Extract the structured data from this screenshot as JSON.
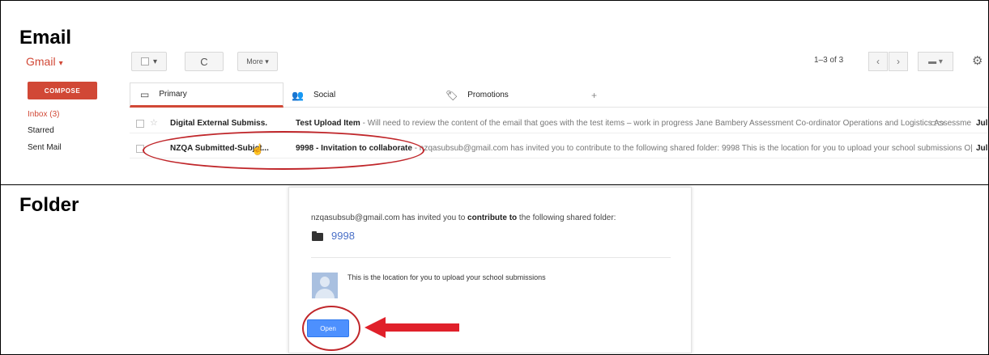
{
  "sections": {
    "email_label": "Email",
    "folder_label": "Folder"
  },
  "gmail": {
    "logo": "Gmail",
    "toolbar": {
      "refresh_glyph": "C",
      "more_label": "More",
      "count": "1–3 of 3"
    },
    "compose_label": "COMPOSE",
    "nav": {
      "inbox": "Inbox (3)",
      "starred": "Starred",
      "sent": "Sent Mail"
    },
    "tabs": [
      "Primary",
      "Social",
      "Promotions"
    ],
    "emails": [
      {
        "sender": "Digital External Submiss.",
        "subject": "Test Upload Item",
        "snippet": " - Will need to review the content of the email that goes with the test items – work in progress Jane Bambery Assessment Co-ordinator Operations and Logistics Assessme",
        "date": "Jul"
      },
      {
        "sender": "NZQA Submitted-Subj",
        "sender_tail": "et...",
        "subject": "9998 - Invitation to collaborate",
        "snippet": " - nzqasubsub@gmail.com has invited you to contribute to the following shared folder: 9998 This is the location for you to upload your school submissions O|",
        "date": "Jul"
      }
    ]
  },
  "folder_card": {
    "invite_prefix": "nzqasubsub@gmail.com has invited you to ",
    "invite_bold": "contribute to",
    "invite_suffix": " the following shared folder:",
    "folder_name": "9998",
    "message": "This is the location for you to upload your school submissions",
    "open_label": "Open"
  },
  "colors": {
    "gmail_red": "#d14836",
    "highlight_red": "#c0262a",
    "link_blue": "#4a70c7",
    "button_blue": "#4d90fe"
  }
}
